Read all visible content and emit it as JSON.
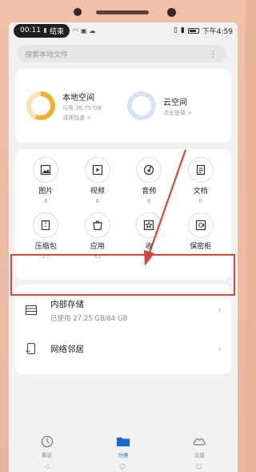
{
  "status_bar": {
    "time": "00:11",
    "pill_label": "结束",
    "right_time": "下午4:59"
  },
  "search": {
    "placeholder": "搜索本地文件",
    "more_icon": "more-dots-icon"
  },
  "storage": {
    "local": {
      "title": "本地空间",
      "available": "可用 36.75 GB",
      "action": "清理加速 >",
      "used_fraction": 0.57,
      "ring_color": "#f2ae2e"
    },
    "cloud": {
      "title": "云空间",
      "action": "点击登录 >"
    }
  },
  "categories": [
    {
      "label": "图片",
      "count": "8",
      "icon": "image-icon"
    },
    {
      "label": "视频",
      "count": "6",
      "icon": "video-icon"
    },
    {
      "label": "音频",
      "count": "6",
      "icon": "audio-icon"
    },
    {
      "label": "文档",
      "count": "0",
      "icon": "document-icon"
    },
    {
      "label": "压缩包",
      "count": "27",
      "icon": "zip-icon"
    },
    {
      "label": "应用",
      "count": "81",
      "icon": "app-icon"
    },
    {
      "label": "收",
      "count": "",
      "icon": "favorites-icon"
    },
    {
      "label": "保密柜",
      "count": "",
      "icon": "safe-icon"
    }
  ],
  "locations": {
    "internal": {
      "title": "内部存储",
      "usage": "已使用 27.25 GB/64 GB"
    },
    "network": {
      "title": "网络邻居"
    }
  },
  "bottom_nav": {
    "recent": "最近",
    "browse": "分类",
    "cloud": "云盘"
  },
  "colors": {
    "accent": "#1769d6",
    "highlight": "#d2473b",
    "arrow": "#d2473b"
  }
}
